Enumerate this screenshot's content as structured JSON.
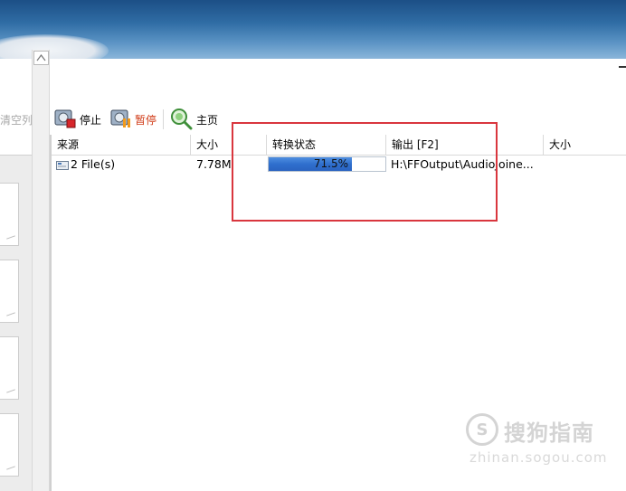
{
  "toolbar": {
    "clear_list": "清空列表",
    "stop": "停止",
    "pause": "暂停",
    "home": "主页"
  },
  "grid": {
    "columns": [
      "来源",
      "大小",
      "转换状态",
      "输出 [F2]",
      "大小"
    ],
    "rows": [
      {
        "source": "2 File(s)",
        "size": "7.78M",
        "status_text": "71.5%",
        "progress": 0.715,
        "output": "H:\\FFOutput\\AudioJoine...",
        "out_size": ""
      }
    ]
  },
  "watermark": {
    "logo_letter": "S",
    "text_cn": "搜狗指南",
    "text_en": "zhinan.sogou.com"
  },
  "colors": {
    "progress_fill": "#2f6fce",
    "highlight_border": "#d9363e",
    "pause_label": "#d03a16"
  }
}
